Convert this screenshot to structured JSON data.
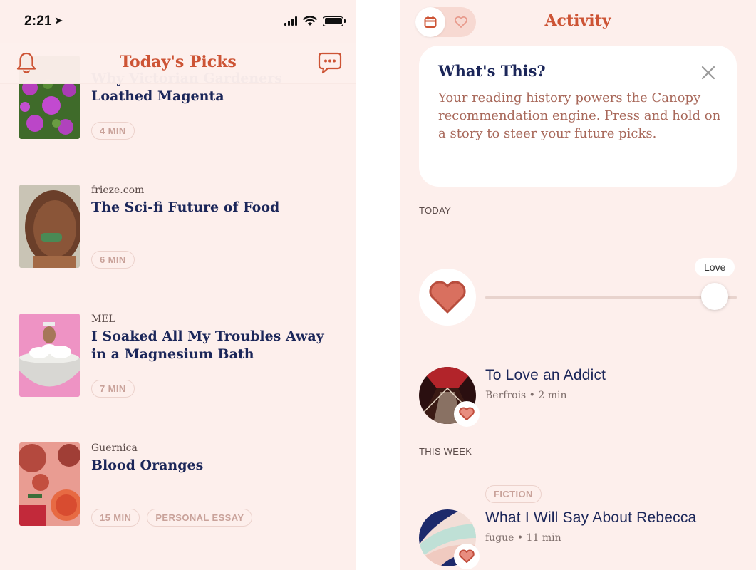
{
  "left_screen": {
    "status_bar": {
      "time": "2:21"
    },
    "header": {
      "title": "Today's Picks"
    },
    "articles": [
      {
        "source": "",
        "title": "Why Victorian Gardeners Loathed Magenta",
        "tags": [
          "4 MIN"
        ]
      },
      {
        "source": "frieze.com",
        "title": "The Sci-fi Future of Food",
        "tags": [
          "6 MIN"
        ]
      },
      {
        "source": "MEL",
        "title": "I Soaked All My Troubles Away in a Magnesium Bath",
        "tags": [
          "7 MIN"
        ]
      },
      {
        "source": "Guernica",
        "title": "Blood Oranges",
        "tags": [
          "15 MIN",
          "PERSONAL ESSAY"
        ]
      }
    ]
  },
  "right_screen": {
    "header": {
      "title": "Activity"
    },
    "info_card": {
      "title": "What's This?",
      "body": "Your reading history powers the Canopy recommendation engine. Press and hold on a story to steer your future picks."
    },
    "sections": {
      "today": "TODAY",
      "this_week": "THIS WEEK"
    },
    "reaction": {
      "label": "Love",
      "level": 1.0
    },
    "stories": [
      {
        "title": "To Love an Addict",
        "meta": "Berfrois • 2 min",
        "tag": ""
      },
      {
        "title": "What I Will Say About Rebecca",
        "meta": "fugue • 11 min",
        "tag": "FICTION"
      }
    ]
  },
  "colors": {
    "background": "#fdefec",
    "accent": "#cd5435",
    "headline": "#1b2659",
    "heart": "#d9705f"
  }
}
